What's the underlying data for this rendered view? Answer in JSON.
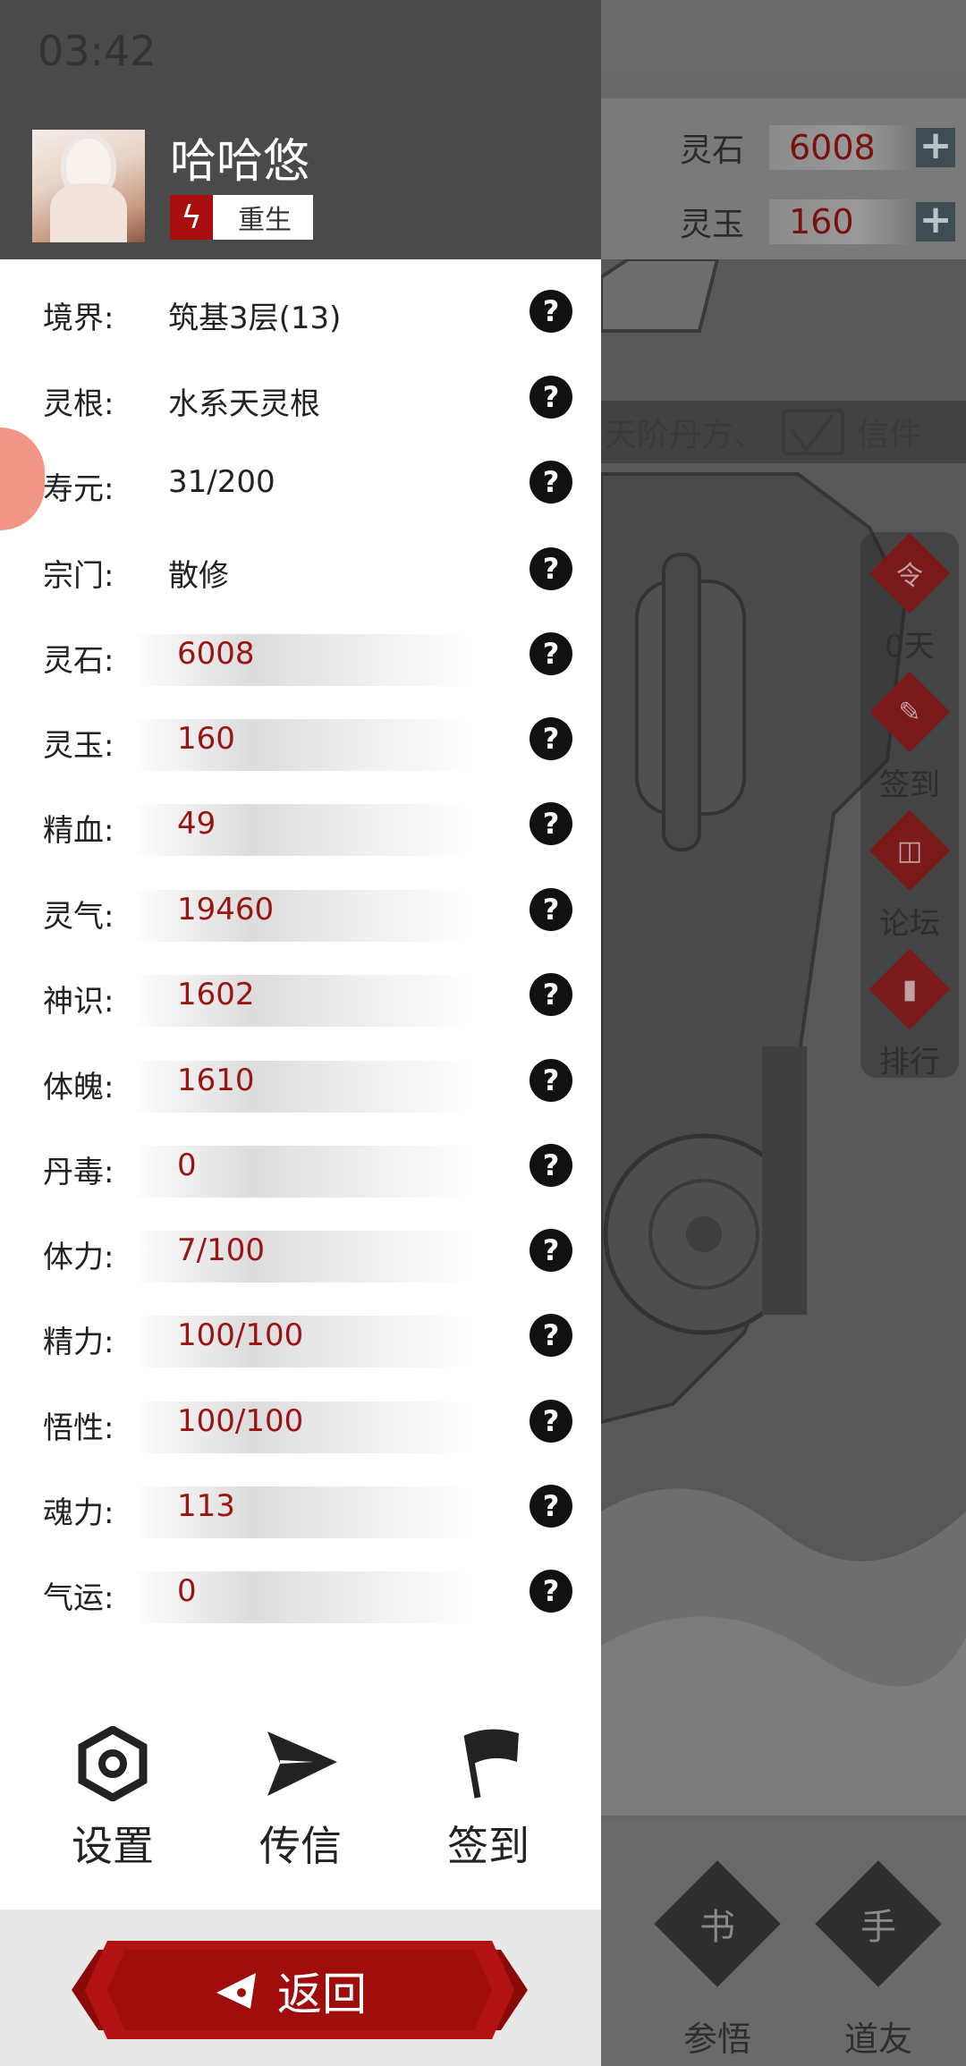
{
  "status_bar": {
    "time": "03:42"
  },
  "resources": [
    {
      "label": "灵石",
      "value": "6008"
    },
    {
      "label": "灵玉",
      "value": "160"
    }
  ],
  "ticker": {
    "text": "天阶丹方、",
    "mail_label": "信件"
  },
  "side_menu": [
    {
      "icon": "令",
      "label": "0天"
    },
    {
      "icon": "✎",
      "label": "签到"
    },
    {
      "icon": "◫",
      "label": "论坛"
    },
    {
      "icon": "▮",
      "label": "排行"
    }
  ],
  "bottom_bar": [
    {
      "icon": "书",
      "label": "参悟"
    },
    {
      "icon": "手",
      "label": "道友"
    }
  ],
  "player": {
    "name": "哈哈悠",
    "badge": "重生"
  },
  "info_rows": [
    {
      "label": "境界:",
      "value": "筑基3层(13)"
    },
    {
      "label": "灵根:",
      "value": "水系天灵根"
    },
    {
      "label": "寿元:",
      "value": "31/200"
    },
    {
      "label": "宗门:",
      "value": "散修"
    }
  ],
  "stat_rows": [
    {
      "label": "灵石:",
      "value": "6008"
    },
    {
      "label": "灵玉:",
      "value": "160"
    },
    {
      "label": "精血:",
      "value": "49"
    },
    {
      "label": "灵气:",
      "value": "19460"
    },
    {
      "label": "神识:",
      "value": "1602"
    },
    {
      "label": "体魄:",
      "value": "1610"
    },
    {
      "label": "丹毒:",
      "value": "0"
    },
    {
      "label": "体力:",
      "value": "7/100"
    },
    {
      "label": "精力:",
      "value": "100/100"
    },
    {
      "label": "悟性:",
      "value": "100/100"
    },
    {
      "label": "魂力:",
      "value": "113"
    },
    {
      "label": "气运:",
      "value": "0"
    }
  ],
  "actions": [
    {
      "label": "设置"
    },
    {
      "label": "传信"
    },
    {
      "label": "签到"
    }
  ],
  "footer": {
    "back_label": "返回"
  },
  "help_glyph": "?"
}
